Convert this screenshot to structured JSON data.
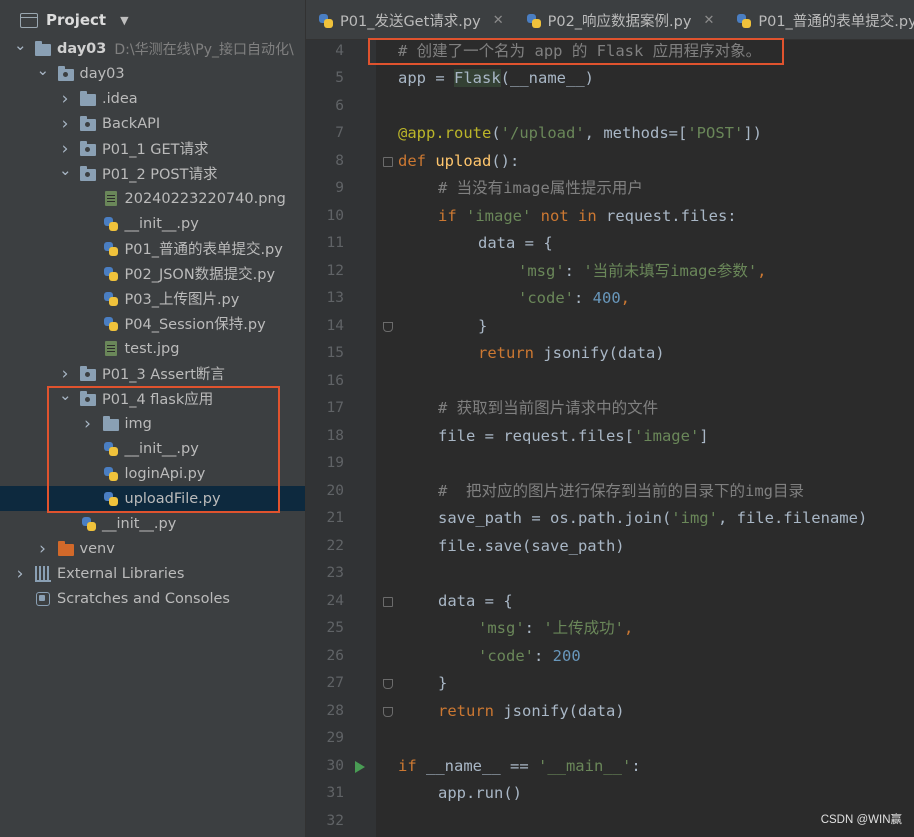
{
  "project_panel": {
    "title": "Project",
    "tree": [
      {
        "label": "day03",
        "path": "D:\\华测在线\\Py_接口自动化\\",
        "level": 0,
        "expanded": true,
        "icon": "folder-icon",
        "bold": true
      },
      {
        "label": "day03",
        "level": 1,
        "expanded": true,
        "icon": "package-icon"
      },
      {
        "label": ".idea",
        "level": 2,
        "expanded": false,
        "icon": "folder-icon"
      },
      {
        "label": "BackAPI",
        "level": 2,
        "expanded": false,
        "icon": "package-icon"
      },
      {
        "label": "P01_1 GET请求",
        "level": 2,
        "expanded": false,
        "icon": "package-icon"
      },
      {
        "label": "P01_2 POST请求",
        "level": 2,
        "expanded": true,
        "icon": "package-icon"
      },
      {
        "label": "20240223220740.png",
        "level": 3,
        "icon": "image-file-icon"
      },
      {
        "label": "__init__.py",
        "level": 3,
        "icon": "python-file-icon"
      },
      {
        "label": "P01_普通的表单提交.py",
        "level": 3,
        "icon": "python-file-icon"
      },
      {
        "label": "P02_JSON数据提交.py",
        "level": 3,
        "icon": "python-file-icon"
      },
      {
        "label": "P03_上传图片.py",
        "level": 3,
        "icon": "python-file-icon"
      },
      {
        "label": "P04_Session保持.py",
        "level": 3,
        "icon": "python-file-icon"
      },
      {
        "label": "test.jpg",
        "level": 3,
        "icon": "image-file-icon"
      },
      {
        "label": "P01_3 Assert断言",
        "level": 2,
        "expanded": false,
        "icon": "package-icon"
      },
      {
        "label": "P01_4 flask应用",
        "level": 2,
        "expanded": true,
        "icon": "package-icon"
      },
      {
        "label": "img",
        "level": 3,
        "expanded": false,
        "icon": "folder-icon"
      },
      {
        "label": "__init__.py",
        "level": 3,
        "icon": "python-file-icon"
      },
      {
        "label": "loginApi.py",
        "level": 3,
        "icon": "python-file-icon"
      },
      {
        "label": "uploadFile.py",
        "level": 3,
        "icon": "python-file-icon",
        "selected": true
      },
      {
        "label": "__init__.py",
        "level": 2,
        "icon": "python-file-icon"
      },
      {
        "label": "venv",
        "level": 1,
        "expanded": false,
        "icon": "venv-folder-icon"
      },
      {
        "label": "External Libraries",
        "level": 0,
        "expanded": false,
        "icon": "libraries-icon"
      },
      {
        "label": "Scratches and Consoles",
        "level": 0,
        "icon": "scratches-icon"
      }
    ]
  },
  "editor_tabs": [
    {
      "label": "P01_发送Get请求.py",
      "closable": true
    },
    {
      "label": "P02_响应数据案例.py",
      "closable": true
    },
    {
      "label": "P01_普通的表单提交.py",
      "closable": false
    }
  ],
  "code_lines": [
    {
      "n": "4",
      "indent": 0,
      "tokens": [
        [
          "c",
          "# 创建了一个名为 app 的 Flask 应用程序对象。"
        ]
      ]
    },
    {
      "n": "5",
      "indent": 0,
      "tokens": [
        [
          "",
          "app = "
        ],
        [
          "fl",
          "Flask"
        ],
        [
          "",
          "(__name__)"
        ]
      ]
    },
    {
      "n": "6",
      "indent": 0,
      "tokens": []
    },
    {
      "n": "7",
      "indent": 0,
      "tokens": [
        [
          "d",
          "@app.route"
        ],
        [
          "",
          "("
        ],
        [
          "s",
          "'/upload'"
        ],
        [
          "",
          ", methods=["
        ],
        [
          "s",
          "'POST'"
        ],
        [
          "",
          "])"
        ]
      ]
    },
    {
      "n": "8",
      "indent": 0,
      "tokens": [
        [
          "k",
          "def "
        ],
        [
          "f",
          "upload"
        ],
        [
          "",
          "():"
        ]
      ]
    },
    {
      "n": "9",
      "indent": 1,
      "tokens": [
        [
          "c",
          "# 当没有image属性提示用户"
        ]
      ]
    },
    {
      "n": "10",
      "indent": 1,
      "tokens": [
        [
          "k",
          "if "
        ],
        [
          "s",
          "'image' "
        ],
        [
          "k",
          "not in "
        ],
        [
          "",
          "request.files:"
        ]
      ]
    },
    {
      "n": "11",
      "indent": 2,
      "tokens": [
        [
          "",
          "data = {"
        ]
      ]
    },
    {
      "n": "12",
      "indent": 3,
      "tokens": [
        [
          "s",
          "'msg'"
        ],
        [
          "",
          ": "
        ],
        [
          "s",
          "'当前未填写image参数'"
        ],
        [
          "k",
          ","
        ]
      ]
    },
    {
      "n": "13",
      "indent": 3,
      "tokens": [
        [
          "s",
          "'code'"
        ],
        [
          "",
          ": "
        ],
        [
          "n",
          "400"
        ],
        [
          "k",
          ","
        ]
      ]
    },
    {
      "n": "14",
      "indent": 2,
      "tokens": [
        [
          "",
          "}"
        ]
      ]
    },
    {
      "n": "15",
      "indent": 2,
      "tokens": [
        [
          "k",
          "return "
        ],
        [
          "",
          "jsonify(data)"
        ]
      ]
    },
    {
      "n": "16",
      "indent": 0,
      "tokens": []
    },
    {
      "n": "17",
      "indent": 1,
      "tokens": [
        [
          "c",
          "# 获取到当前图片请求中的文件"
        ]
      ]
    },
    {
      "n": "18",
      "indent": 1,
      "tokens": [
        [
          "",
          "file = request.files["
        ],
        [
          "s",
          "'image'"
        ],
        [
          "",
          "]"
        ]
      ]
    },
    {
      "n": "19",
      "indent": 0,
      "tokens": []
    },
    {
      "n": "20",
      "indent": 1,
      "tokens": [
        [
          "c",
          "#  把对应的图片进行保存到当前的目录下的img目录"
        ]
      ]
    },
    {
      "n": "21",
      "indent": 1,
      "tokens": [
        [
          "",
          "save_path = os.path.join("
        ],
        [
          "s",
          "'img'"
        ],
        [
          "",
          ", file.filename)"
        ]
      ]
    },
    {
      "n": "22",
      "indent": 1,
      "tokens": [
        [
          "",
          "file.save(save_path)"
        ]
      ]
    },
    {
      "n": "23",
      "indent": 0,
      "tokens": []
    },
    {
      "n": "24",
      "indent": 1,
      "tokens": [
        [
          "",
          "data = {"
        ]
      ]
    },
    {
      "n": "25",
      "indent": 2,
      "tokens": [
        [
          "s",
          "'msg'"
        ],
        [
          "",
          ": "
        ],
        [
          "s",
          "'上传成功'"
        ],
        [
          "k",
          ","
        ]
      ]
    },
    {
      "n": "26",
      "indent": 2,
      "tokens": [
        [
          "s",
          "'code'"
        ],
        [
          "",
          ": "
        ],
        [
          "n",
          "200"
        ]
      ]
    },
    {
      "n": "27",
      "indent": 1,
      "tokens": [
        [
          "",
          "}"
        ]
      ]
    },
    {
      "n": "28",
      "indent": 1,
      "tokens": [
        [
          "k",
          "return "
        ],
        [
          "",
          "jsonify(data)"
        ]
      ]
    },
    {
      "n": "29",
      "indent": 0,
      "tokens": []
    },
    {
      "n": "30",
      "indent": 0,
      "tokens": [
        [
          "k",
          "if "
        ],
        [
          "",
          "__name__ == "
        ],
        [
          "s",
          "'__main__'"
        ],
        [
          "",
          ":"
        ]
      ]
    },
    {
      "n": "31",
      "indent": 1,
      "tokens": [
        [
          "",
          "app.run()"
        ]
      ]
    },
    {
      "n": "32",
      "indent": 0,
      "tokens": []
    }
  ],
  "watermark": "CSDN @WIN赢",
  "colors": {
    "highlight_box": "#e0532e",
    "selection": "#0d293e",
    "keyword": "#cc7832",
    "string": "#6a8759",
    "comment": "#808080",
    "number": "#6897bb",
    "function": "#ffc66d",
    "decorator": "#bbb529"
  }
}
